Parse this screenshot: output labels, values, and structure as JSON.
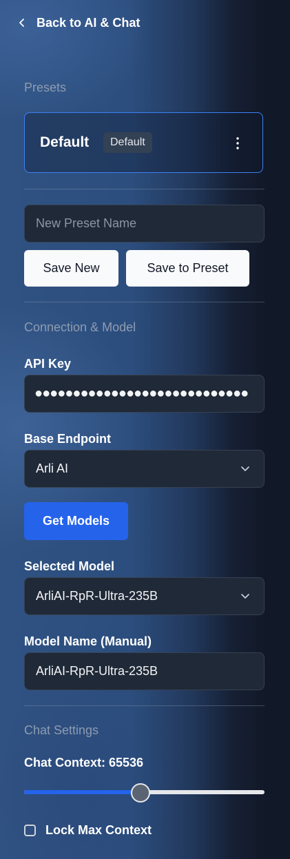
{
  "header": {
    "back_label": "Back to AI & Chat"
  },
  "presets": {
    "section_title": "Presets",
    "active": {
      "name": "Default",
      "badge": "Default"
    },
    "new_preset_placeholder": "New Preset Name",
    "save_new_label": "Save New",
    "save_to_preset_label": "Save to Preset"
  },
  "connection": {
    "section_title": "Connection & Model",
    "api_key_label": "API Key",
    "api_key_masked": "●●●●●●●●●●●●●●●●●●●●●●●●●●●●",
    "base_endpoint_label": "Base Endpoint",
    "base_endpoint_value": "Arli AI",
    "get_models_label": "Get Models",
    "selected_model_label": "Selected Model",
    "selected_model_value": "ArliAI-RpR-Ultra-235B",
    "model_name_label": "Model Name (Manual)",
    "model_name_value": "ArliAI-RpR-Ultra-235B"
  },
  "chat_settings": {
    "section_title": "Chat Settings",
    "context_label": "Chat Context: 65536",
    "context_slider_fraction": 0.48,
    "lock_max_context_label": "Lock Max Context",
    "lock_max_context_checked": false
  },
  "colors": {
    "accent": "#2563eb",
    "card_border": "#3b82f6"
  }
}
